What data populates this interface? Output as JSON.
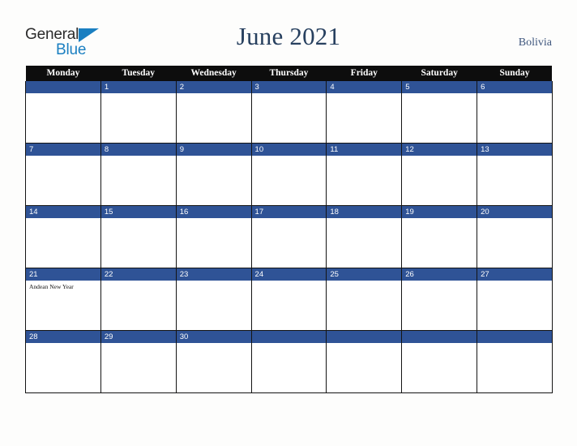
{
  "brand": {
    "name_part1": "General",
    "name_part2": "Blue",
    "triangle_icon": "blue-triangle-icon",
    "accent_color": "#1a7fc1"
  },
  "header": {
    "title": "June 2021",
    "country": "Bolivia",
    "title_color": "#27405f"
  },
  "calendar": {
    "month": "June",
    "year": "2021",
    "weekday_headers": [
      "Monday",
      "Tuesday",
      "Wednesday",
      "Thursday",
      "Friday",
      "Saturday",
      "Sunday"
    ],
    "header_bg_color": "#0d0d0d",
    "daynum_band_color": "#2f5396",
    "weeks": [
      [
        {
          "day": "",
          "events": []
        },
        {
          "day": "1",
          "events": []
        },
        {
          "day": "2",
          "events": []
        },
        {
          "day": "3",
          "events": []
        },
        {
          "day": "4",
          "events": []
        },
        {
          "day": "5",
          "events": []
        },
        {
          "day": "6",
          "events": []
        }
      ],
      [
        {
          "day": "7",
          "events": []
        },
        {
          "day": "8",
          "events": []
        },
        {
          "day": "9",
          "events": []
        },
        {
          "day": "10",
          "events": []
        },
        {
          "day": "11",
          "events": []
        },
        {
          "day": "12",
          "events": []
        },
        {
          "day": "13",
          "events": []
        }
      ],
      [
        {
          "day": "14",
          "events": []
        },
        {
          "day": "15",
          "events": []
        },
        {
          "day": "16",
          "events": []
        },
        {
          "day": "17",
          "events": []
        },
        {
          "day": "18",
          "events": []
        },
        {
          "day": "19",
          "events": []
        },
        {
          "day": "20",
          "events": []
        }
      ],
      [
        {
          "day": "21",
          "events": [
            "Andean New Year"
          ]
        },
        {
          "day": "22",
          "events": []
        },
        {
          "day": "23",
          "events": []
        },
        {
          "day": "24",
          "events": []
        },
        {
          "day": "25",
          "events": []
        },
        {
          "day": "26",
          "events": []
        },
        {
          "day": "27",
          "events": []
        }
      ],
      [
        {
          "day": "28",
          "events": []
        },
        {
          "day": "29",
          "events": []
        },
        {
          "day": "30",
          "events": []
        },
        {
          "day": "",
          "events": []
        },
        {
          "day": "",
          "events": []
        },
        {
          "day": "",
          "events": []
        },
        {
          "day": "",
          "events": []
        }
      ]
    ]
  }
}
